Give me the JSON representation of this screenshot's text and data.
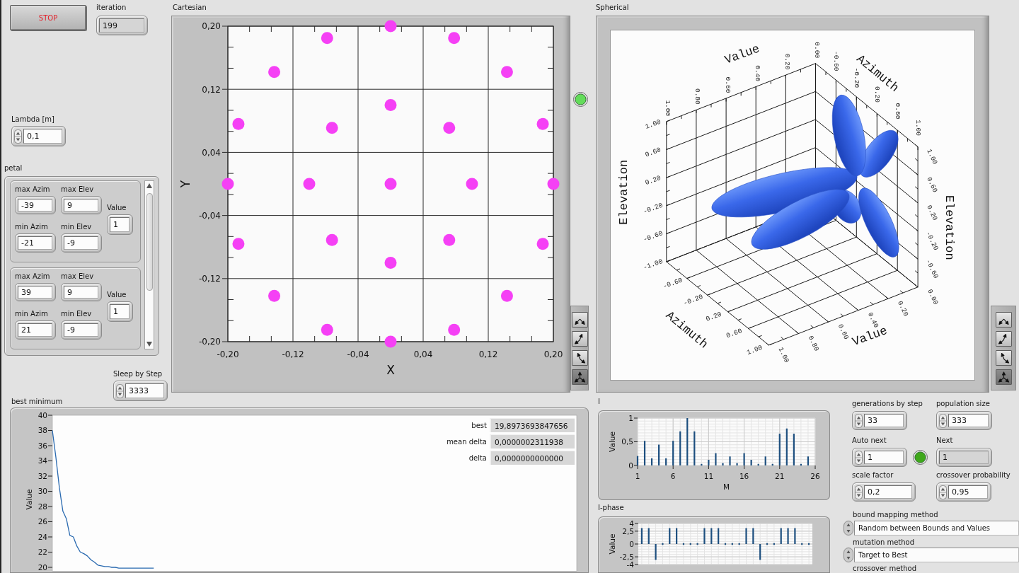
{
  "stop_button": {
    "label": "STOP"
  },
  "iteration": {
    "label": "iteration",
    "value": "199"
  },
  "lambda": {
    "label": "Lambda [m]",
    "value": "0,1"
  },
  "petal": {
    "label": "petal",
    "items": [
      {
        "max_azim": {
          "label": "max Azim",
          "value": "-39"
        },
        "max_elev": {
          "label": "max Elev",
          "value": "9"
        },
        "value": {
          "label": "Value",
          "value": "1"
        },
        "min_azim": {
          "label": "min Azim",
          "value": "-21"
        },
        "min_elev": {
          "label": "min Elev",
          "value": "-9"
        }
      },
      {
        "max_azim": {
          "label": "max Azim",
          "value": "39"
        },
        "max_elev": {
          "label": "max Elev",
          "value": "9"
        },
        "value": {
          "label": "Value",
          "value": "1"
        },
        "min_azim": {
          "label": "min Azim",
          "value": "21"
        },
        "min_elev": {
          "label": "min Elev",
          "value": "-9"
        }
      }
    ]
  },
  "sleep_by_step": {
    "label": "Sleep by Step",
    "value": "3333"
  },
  "cartesian": {
    "label": "Cartesian",
    "chart_data": {
      "type": "scatter",
      "xlabel": "X",
      "ylabel": "Y",
      "grid": true,
      "xlim": [
        -0.2,
        0.2
      ],
      "ylim": [
        -0.2,
        0.2
      ],
      "xticks": [
        {
          "value": -0.2,
          "label": "-0,20"
        },
        {
          "value": -0.12,
          "label": "-0,12"
        },
        {
          "value": -0.04,
          "label": "-0,04"
        },
        {
          "value": 0.04,
          "label": "0,04"
        },
        {
          "value": 0.12,
          "label": "0,12"
        },
        {
          "value": 0.2,
          "label": "0,20"
        }
      ],
      "yticks": [
        {
          "value": 0.2,
          "label": "0,20"
        },
        {
          "value": 0.12,
          "label": "0,12"
        },
        {
          "value": 0.04,
          "label": "0,04"
        },
        {
          "value": -0.04,
          "label": "-0,04"
        },
        {
          "value": -0.12,
          "label": "-0,12"
        },
        {
          "value": -0.2,
          "label": "-0,20"
        }
      ],
      "x": [
        -0.078,
        0,
        0.078,
        -0.143,
        0.143,
        0,
        -0.187,
        -0.072,
        0.072,
        0.187,
        -0.2,
        -0.1,
        0,
        0.1,
        0.2,
        -0.187,
        -0.072,
        0.072,
        0.187,
        0,
        -0.143,
        0.143,
        -0.078,
        0,
        0.078
      ],
      "series": [
        {
          "color": "#f540f5",
          "values": [
            0.185,
            0.2,
            0.185,
            0.142,
            0.142,
            0.1,
            0.076,
            0.071,
            0.071,
            0.076,
            0,
            0,
            0,
            0,
            0,
            -0.076,
            -0.071,
            -0.071,
            -0.076,
            -0.1,
            -0.142,
            -0.142,
            -0.185,
            -0.2,
            -0.185
          ]
        }
      ]
    },
    "palette": [
      {
        "kind": "xy",
        "selected": false
      },
      {
        "kind": "xz",
        "selected": false
      },
      {
        "kind": "zy",
        "selected": false
      },
      {
        "kind": "xyz",
        "selected": true
      }
    ]
  },
  "indicator_led": {
    "on": true
  },
  "spherical": {
    "label": "Spherical",
    "axes": [
      {
        "title": "Value",
        "ticks": [
          "1.00",
          "0.80",
          "0.60",
          "0.40",
          "0.20",
          "0.00"
        ]
      },
      {
        "title": "Azimuth",
        "ticks": [
          "-0.60",
          "-0.20",
          "0.20",
          "0.60",
          "1.00"
        ]
      },
      {
        "title": "Elevation",
        "ticks": [
          "1.00",
          "0.60",
          "0.20",
          "-0.20",
          "-0.60",
          "-1.00"
        ]
      },
      {
        "title": "Azimuth",
        "ticks": [
          "-0.60",
          "-0.20",
          "0.20",
          "0.60",
          "1.00"
        ]
      },
      {
        "title": "Value",
        "ticks": [
          "1.00",
          "0.80",
          "0.60",
          "0.40",
          "0.20",
          "0.00"
        ]
      },
      {
        "title": "Elevation",
        "ticks": [
          "1.00",
          "0.60",
          "0.20",
          "-0.20",
          "-0.60"
        ]
      }
    ],
    "palette": [
      {
        "kind": "xy",
        "selected": false
      },
      {
        "kind": "xz",
        "selected": false
      },
      {
        "kind": "zy",
        "selected": false
      },
      {
        "kind": "xyz",
        "selected": true
      }
    ]
  },
  "best_minimum": {
    "label": "best minimum",
    "chart_data": {
      "type": "line",
      "ylabel": "Value",
      "ylim": [
        19.5,
        40
      ],
      "yticks": [
        20,
        22,
        24,
        26,
        28,
        30,
        32,
        34,
        36,
        38,
        40
      ],
      "series": [
        {
          "color": "#2a6ab0",
          "values": [
            38.0,
            34.5,
            30.5,
            27.4,
            26.4,
            24.2,
            24.0,
            22.8,
            22.0,
            21.8,
            21.5,
            21.0,
            20.7,
            20.3,
            20.2,
            20.1,
            20.1,
            20.0,
            20.0,
            19.9,
            19.9,
            19.9,
            19.9,
            19.9,
            19.9,
            19.9,
            19.9,
            19.9,
            19.9,
            19.9
          ]
        }
      ]
    },
    "readouts": [
      {
        "label": "best",
        "value": "19,8973693847656"
      },
      {
        "label": "mean delta",
        "value": "0,0000002311938"
      },
      {
        "label": "delta",
        "value": "0,0000000000000"
      }
    ]
  },
  "graph_i": {
    "label": "I",
    "chart_data": {
      "type": "bar",
      "xlabel": "M",
      "ylabel": "Value",
      "grid": true,
      "xlim": [
        1,
        26
      ],
      "ylim": [
        0,
        1
      ],
      "xticks": [
        1,
        6,
        11,
        16,
        21,
        26
      ],
      "yticks": [
        {
          "value": 0,
          "label": "0"
        },
        {
          "value": 0.5,
          "label": "0,5"
        },
        {
          "value": 1,
          "label": "1"
        }
      ],
      "x": [
        1,
        2,
        3,
        4,
        5,
        6,
        7,
        8,
        9,
        10,
        11,
        12,
        13,
        14,
        15,
        16,
        17,
        18,
        19,
        20,
        21,
        22,
        23,
        24,
        25
      ],
      "series": [
        {
          "color": "#1d4f7f",
          "values": [
            0.2,
            0.52,
            0.15,
            0.44,
            0.15,
            0.52,
            0.72,
            1.0,
            0.72,
            0.03,
            0.12,
            0.26,
            0.05,
            0.19,
            0.05,
            0.26,
            0.12,
            0.03,
            0.19,
            0.03,
            0.67,
            0.78,
            0.67,
            0.03,
            0.19
          ]
        }
      ]
    }
  },
  "graph_i_phase": {
    "label": "I-phase",
    "chart_data": {
      "type": "bar",
      "ylabel": "Value",
      "grid": true,
      "ylim": [
        -4,
        4
      ],
      "yticks": [
        {
          "value": 4,
          "label": "4"
        },
        {
          "value": 2.5,
          "label": "2,5"
        },
        {
          "value": 0,
          "label": "0"
        },
        {
          "value": -2.5,
          "label": "-2,5"
        },
        {
          "value": -4,
          "label": "-4"
        }
      ],
      "series": [
        {
          "color": "#1d4f7f",
          "values": [
            3.1,
            3.1,
            -3.1,
            0,
            3.1,
            3.1,
            0,
            0,
            0,
            3.1,
            3.1,
            3.1,
            0,
            0,
            0,
            3.1,
            3.1,
            -3.1,
            0,
            0,
            3.1,
            3.1,
            3.1,
            0,
            0
          ]
        }
      ]
    }
  },
  "generations_by_step": {
    "label": "generations by step",
    "value": "33"
  },
  "population_size": {
    "label": "population size",
    "value": "333"
  },
  "auto_next": {
    "label": "Auto next",
    "value": "1",
    "led_on": true
  },
  "next": {
    "label": "Next",
    "value": "1"
  },
  "scale_factor": {
    "label": "scale factor",
    "value": "0,2"
  },
  "crossover_probability": {
    "label": "crossover probability",
    "value": "0,95"
  },
  "bound_mapping_method": {
    "label": "bound mapping method",
    "value": "Random between Bounds and Values"
  },
  "mutation_method": {
    "label": "mutation method",
    "value": "Target to Best"
  },
  "crossover_method": {
    "label": "crossover method"
  }
}
